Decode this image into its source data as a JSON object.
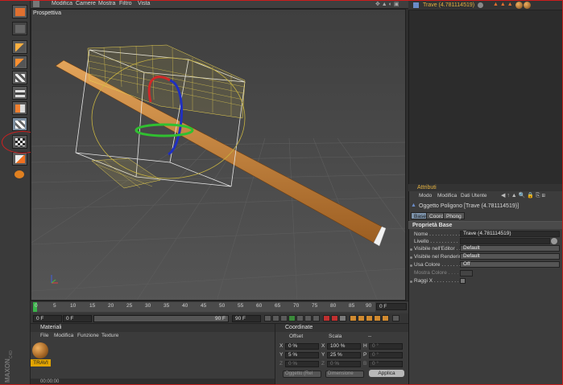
{
  "topbar": {
    "menus": [
      "Modifica",
      "Camere",
      "Mostra",
      "Filtro",
      "Vista"
    ]
  },
  "viewport": {
    "label": "Prospettiva"
  },
  "timeline": {
    "ticks": [
      "0",
      "5",
      "10",
      "15",
      "20",
      "25",
      "30",
      "35",
      "40",
      "45",
      "50",
      "55",
      "60",
      "65",
      "70",
      "75",
      "80",
      "85",
      "90"
    ],
    "end_frame": "0 F"
  },
  "transport": {
    "current_frame": "0 F",
    "field_a": "0 F",
    "range_value": "90 F",
    "max_frame": "90 F"
  },
  "materials": {
    "title": "Materiali",
    "menus": [
      "File",
      "Modifica",
      "Funzione",
      "Texture"
    ],
    "items": [
      {
        "name": "TRAVI"
      }
    ],
    "status_time": "00:00:00"
  },
  "coordinates": {
    "title": "Coordinate",
    "col_offset": "Offset",
    "col_scale": "Scala",
    "col_rot": "--",
    "rows": [
      {
        "axis": "X",
        "pos": "0 %",
        "axis2": "X",
        "scale": "100 %",
        "axis3": "H",
        "rot": "0 °"
      },
      {
        "axis": "Y",
        "pos": "5 %",
        "axis2": "Y",
        "scale": "25 %",
        "axis3": "P",
        "rot": "0 °"
      },
      {
        "axis": "Z",
        "pos": "0 %",
        "axis2": "Z",
        "scale": "0 %",
        "axis3": "B",
        "rot": "0 °"
      }
    ],
    "mode_select": "Oggetto (Rel",
    "size_select": "Dimensione",
    "apply_label": "Applica"
  },
  "object_manager": {
    "object_name": "Trave (4.781114519)"
  },
  "attributes": {
    "title": "Attributi",
    "menus": [
      "Modo",
      "Modifica",
      "Dati Utente"
    ],
    "object_title": "Oggetto Poligono [Trave (4.781114519)]",
    "tabs": [
      "Base",
      "Coord.",
      "Phong"
    ],
    "active_tab": "Base",
    "section": "Proprietà Base",
    "props": [
      {
        "label": "Nome . . . . . . . . . . . . .",
        "value": "Trave (4.781114519)"
      },
      {
        "label": "Livello . . . . . . . . . . . .",
        "value": ""
      },
      {
        "label": "Visibile nell'Editor . .",
        "value": "Default"
      },
      {
        "label": "Visibile nel Rendering",
        "value": "Default"
      },
      {
        "label": "Usa Colore . . . . . . .",
        "value": "Off"
      },
      {
        "label": "Mostra Colore . . . . . .",
        "value": ""
      },
      {
        "label": "Raggi X . . . . . . . . . . .",
        "value": ""
      }
    ]
  },
  "colors": {
    "accent": "#e2b040",
    "wood": "#c8843a",
    "active_tab": "#7d93ab"
  }
}
